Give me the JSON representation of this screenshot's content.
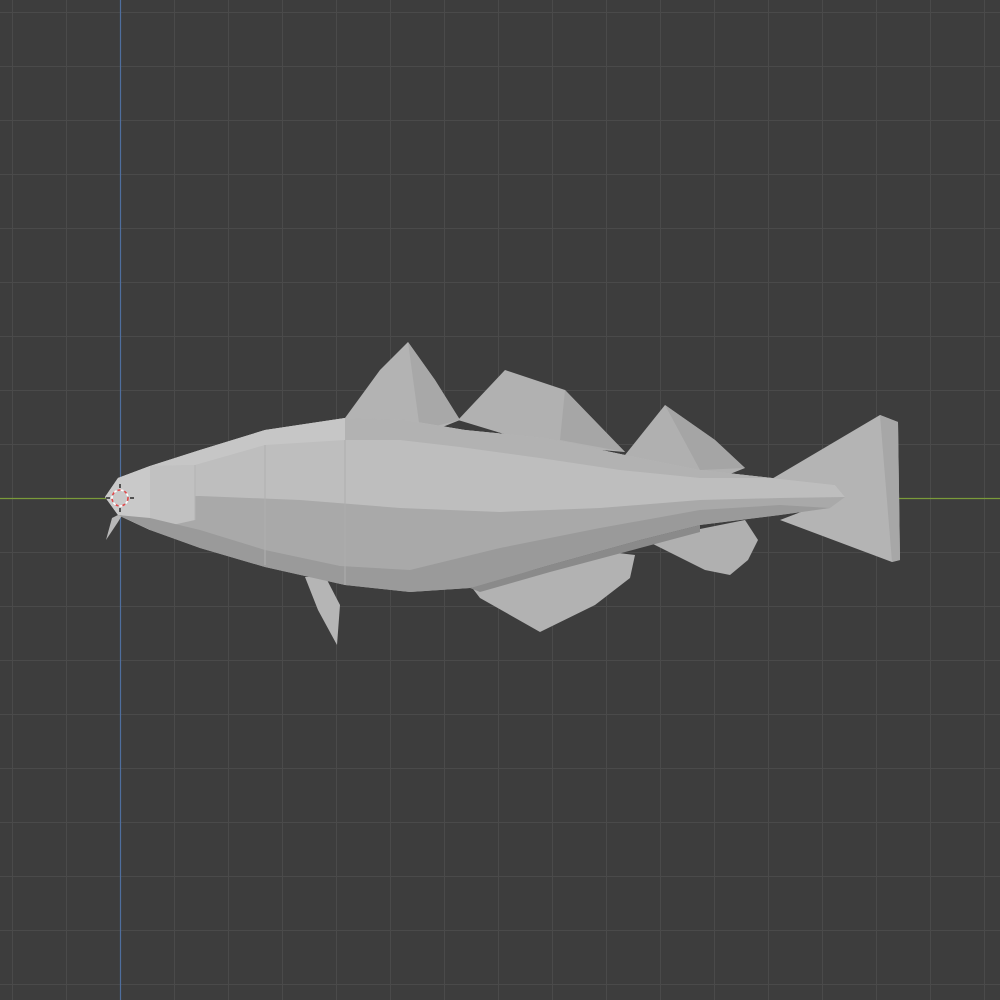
{
  "viewport": {
    "editor": "3d-viewport",
    "view": "side-orthographic",
    "shading": "solid",
    "colors": {
      "background": "#3d3d3d",
      "grid_line": "#4a4a4a",
      "x_axis": "#7a9a3a",
      "z_axis": "#4f6e9e",
      "cursor_red": "#e0484a",
      "cursor_white": "#ffffff"
    },
    "object": {
      "name": "",
      "type": "mesh",
      "icon": "fish-mesh-icon"
    }
  }
}
